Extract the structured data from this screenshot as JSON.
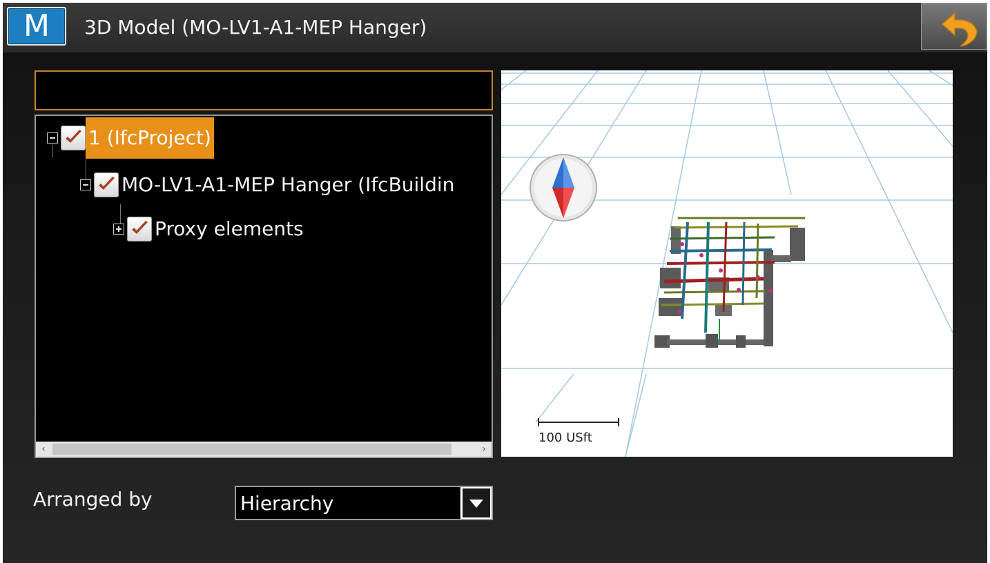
{
  "titlebar": {
    "logo_letter": "M",
    "title": "3D Model (MO-LV1-A1-MEP Hanger)"
  },
  "search": {
    "value": ""
  },
  "tree": {
    "nodes": [
      {
        "label": "1 (IfcProject)",
        "checked": true,
        "expanded": true,
        "selected": true
      },
      {
        "label": "MO-LV1-A1-MEP Hanger (IfcBuildin",
        "checked": true,
        "expanded": true,
        "selected": false
      },
      {
        "label": "Proxy elements",
        "checked": true,
        "expanded": false,
        "selected": false
      }
    ]
  },
  "viewport": {
    "scale_label": "100 USft",
    "grid_color": "#a8cbe6"
  },
  "arrange": {
    "label": "Arranged by",
    "value": "Hierarchy"
  },
  "colors": {
    "accent": "#e8901a",
    "logo": "#1d7fc0",
    "check": "#a8452a"
  }
}
